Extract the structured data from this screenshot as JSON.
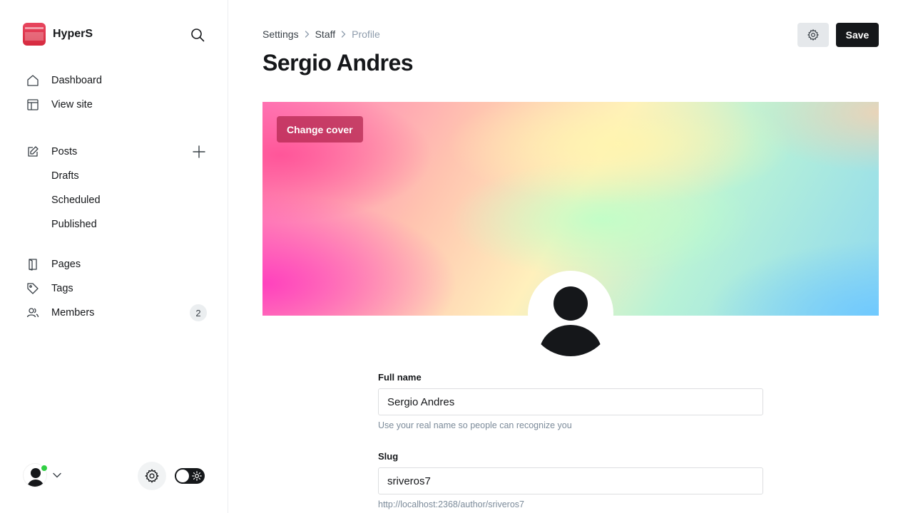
{
  "brand": {
    "name": "HyperS",
    "logo_color": "#e2384f"
  },
  "nav": {
    "dashboard": "Dashboard",
    "view_site": "View site",
    "posts": "Posts",
    "drafts": "Drafts",
    "scheduled": "Scheduled",
    "published": "Published",
    "pages": "Pages",
    "tags": "Tags",
    "members": "Members",
    "members_count": "2"
  },
  "icons": {
    "search": "search-icon",
    "dashboard": "home-icon",
    "view_site": "layout-icon",
    "posts": "pencil-square-icon",
    "add_post": "plus-icon",
    "pages": "page-icon",
    "tags": "tag-icon",
    "members": "members-icon",
    "settings": "gear-icon",
    "theme": "sun-icon"
  },
  "breadcrumb": {
    "settings": "Settings",
    "staff": "Staff",
    "profile": "Profile"
  },
  "page": {
    "title": "Sergio Andres"
  },
  "toolbar": {
    "save_label": "Save"
  },
  "cover": {
    "change_label": "Change cover"
  },
  "form": {
    "full_name": {
      "label": "Full name",
      "value": "Sergio Andres",
      "hint": "Use your real name so people can recognize you"
    },
    "slug": {
      "label": "Slug",
      "value": "sriveros7",
      "hint": "http://localhost:2368/author/sriveros7"
    }
  },
  "status": {
    "online_color": "#30cf43"
  }
}
